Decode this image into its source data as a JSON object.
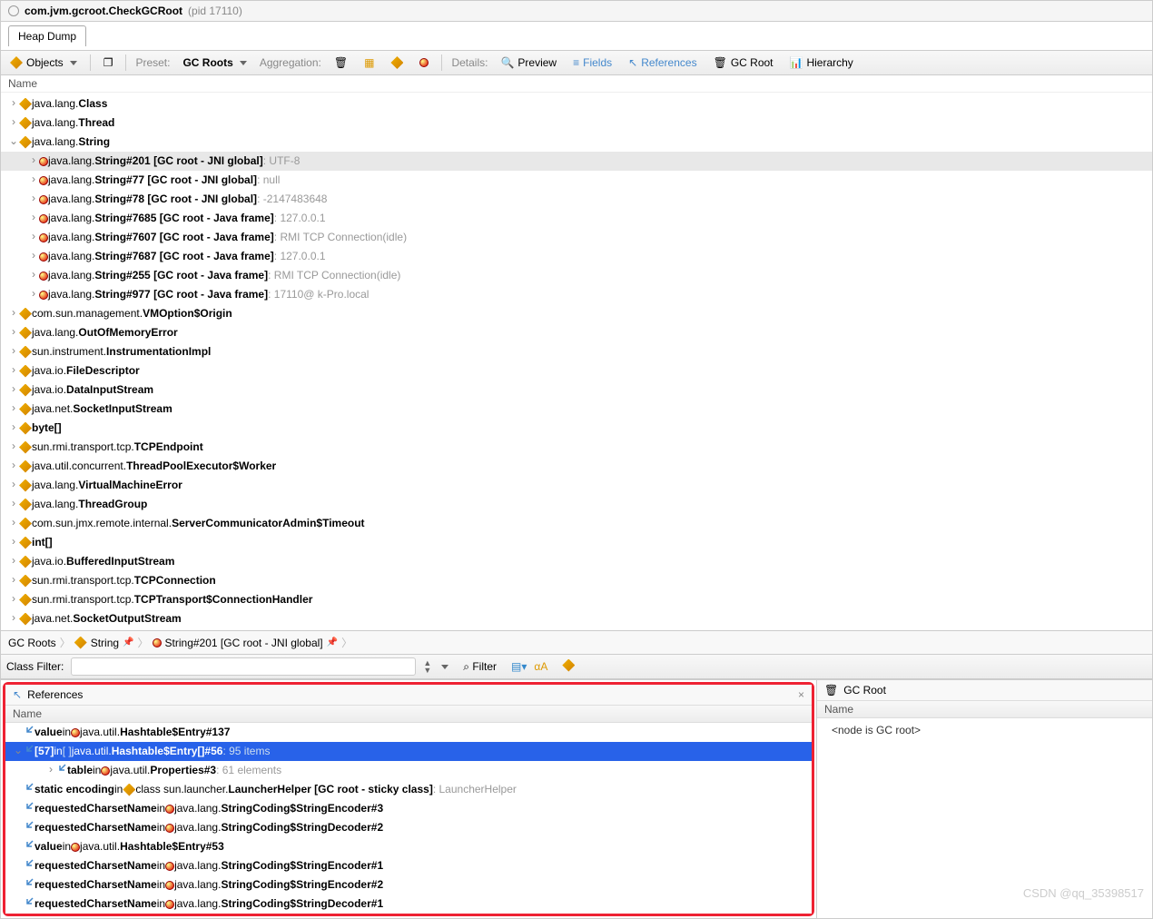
{
  "title": {
    "cls": "com.jvm.gcroot.CheckGCRoot",
    "pid": "(pid 17110)"
  },
  "tab": "Heap Dump",
  "toolbar": {
    "objects": "Objects",
    "preset_lbl": "Preset:",
    "preset_val": "GC Roots",
    "agg_lbl": "Aggregation:",
    "details_lbl": "Details:",
    "preview": "Preview",
    "fields": "Fields",
    "refs": "References",
    "gcroot": "GC Root",
    "hierarchy": "Hierarchy"
  },
  "tree_head": "Name",
  "tree": [
    {
      "lvl": 0,
      "chev": "›",
      "t": "class",
      "pkg": "java.lang.",
      "cls": "Class"
    },
    {
      "lvl": 0,
      "chev": "›",
      "t": "class",
      "pkg": "java.lang.",
      "cls": "Thread"
    },
    {
      "lvl": 0,
      "chev": "⌄",
      "t": "class",
      "pkg": "java.lang.",
      "cls": "String"
    },
    {
      "lvl": 1,
      "chev": "›",
      "t": "inst",
      "sel": true,
      "pkg": "java.lang.",
      "cls": "String#201 [GC root - JNI global]",
      "extra": " : UTF-8"
    },
    {
      "lvl": 1,
      "chev": "›",
      "t": "inst",
      "pkg": "java.lang.",
      "cls": "String#77 [GC root - JNI global]",
      "extra": " : null"
    },
    {
      "lvl": 1,
      "chev": "›",
      "t": "inst",
      "pkg": "java.lang.",
      "cls": "String#78 [GC root - JNI global]",
      "extra": " : -2147483648"
    },
    {
      "lvl": 1,
      "chev": "›",
      "t": "inst",
      "pkg": "java.lang.",
      "cls": "String#7685 [GC root - Java frame]",
      "extra": " : 127.0.0.1"
    },
    {
      "lvl": 1,
      "chev": "›",
      "t": "inst",
      "pkg": "java.lang.",
      "cls": "String#7607 [GC root - Java frame]",
      "extra": " : RMI TCP Connection(idle)"
    },
    {
      "lvl": 1,
      "chev": "›",
      "t": "inst",
      "pkg": "java.lang.",
      "cls": "String#7687 [GC root - Java frame]",
      "extra": " : 127.0.0.1"
    },
    {
      "lvl": 1,
      "chev": "›",
      "t": "inst",
      "pkg": "java.lang.",
      "cls": "String#255 [GC root - Java frame]",
      "extra": " : RMI TCP Connection(idle)"
    },
    {
      "lvl": 1,
      "chev": "›",
      "t": "inst",
      "pkg": "java.lang.",
      "cls": "String#977 [GC root - Java frame]",
      "extra": " : 17110@            k-Pro.local"
    },
    {
      "lvl": 0,
      "chev": "›",
      "t": "class",
      "pkg": "com.sun.management.",
      "cls": "VMOption$Origin"
    },
    {
      "lvl": 0,
      "chev": "›",
      "t": "class",
      "pkg": "java.lang.",
      "cls": "OutOfMemoryError"
    },
    {
      "lvl": 0,
      "chev": "›",
      "t": "class",
      "pkg": "sun.instrument.",
      "cls": "InstrumentationImpl"
    },
    {
      "lvl": 0,
      "chev": "›",
      "t": "class",
      "pkg": "java.io.",
      "cls": "FileDescriptor"
    },
    {
      "lvl": 0,
      "chev": "›",
      "t": "class",
      "pkg": "java.io.",
      "cls": "DataInputStream"
    },
    {
      "lvl": 0,
      "chev": "›",
      "t": "class",
      "pkg": "java.net.",
      "cls": "SocketInputStream"
    },
    {
      "lvl": 0,
      "chev": "›",
      "t": "class",
      "pkg": "",
      "cls": "byte[]"
    },
    {
      "lvl": 0,
      "chev": "›",
      "t": "class",
      "pkg": "sun.rmi.transport.tcp.",
      "cls": "TCPEndpoint"
    },
    {
      "lvl": 0,
      "chev": "›",
      "t": "class",
      "pkg": "java.util.concurrent.",
      "cls": "ThreadPoolExecutor$Worker"
    },
    {
      "lvl": 0,
      "chev": "›",
      "t": "class",
      "pkg": "java.lang.",
      "cls": "VirtualMachineError"
    },
    {
      "lvl": 0,
      "chev": "›",
      "t": "class",
      "pkg": "java.lang.",
      "cls": "ThreadGroup"
    },
    {
      "lvl": 0,
      "chev": "›",
      "t": "class",
      "pkg": "com.sun.jmx.remote.internal.",
      "cls": "ServerCommunicatorAdmin$Timeout"
    },
    {
      "lvl": 0,
      "chev": "›",
      "t": "class",
      "pkg": "",
      "cls": "int[]"
    },
    {
      "lvl": 0,
      "chev": "›",
      "t": "class",
      "pkg": "java.io.",
      "cls": "BufferedInputStream"
    },
    {
      "lvl": 0,
      "chev": "›",
      "t": "class",
      "pkg": "sun.rmi.transport.tcp.",
      "cls": "TCPConnection"
    },
    {
      "lvl": 0,
      "chev": "›",
      "t": "class",
      "pkg": "sun.rmi.transport.tcp.",
      "cls": "TCPTransport$ConnectionHandler"
    },
    {
      "lvl": 0,
      "chev": "›",
      "t": "class",
      "pkg": "java.net.",
      "cls": "SocketOutputStream"
    }
  ],
  "breadcrumb": {
    "a": "GC Roots",
    "b": "String",
    "c": "String#201 [GC root - JNI global]"
  },
  "filter": {
    "lbl": "Class Filter:",
    "btn": "Filter"
  },
  "refs": {
    "title": "References",
    "head": "Name",
    "rows": [
      {
        "lvl": 0,
        "chev": "",
        "fld": "value",
        "in": " in ",
        "t": "inst",
        "pkg": "java.util.",
        "cls": "Hashtable$Entry#137"
      },
      {
        "lvl": 0,
        "chev": "⌄",
        "hl": true,
        "fld": "[57]",
        "in": " in ",
        "t": "arr",
        "pkg": "java.util.",
        "cls": "Hashtable$Entry[]#56",
        "extra": " : 95 items"
      },
      {
        "lvl": 2,
        "chev": "›",
        "fld": "table",
        "in": " in ",
        "t": "inst",
        "pkg": "java.util.",
        "cls": "Properties#3",
        "extra": " : 61 elements"
      },
      {
        "lvl": 0,
        "chev": "",
        "fld": "static encoding",
        "in": " in ",
        "t": "cls",
        "pkg": "class sun.launcher.",
        "cls": "LauncherHelper [GC root - sticky class]",
        "extra": " : LauncherHelper"
      },
      {
        "lvl": 0,
        "chev": "",
        "fld": "requestedCharsetName",
        "in": " in ",
        "t": "inst",
        "pkg": "java.lang.",
        "cls": "StringCoding$StringEncoder#3"
      },
      {
        "lvl": 0,
        "chev": "",
        "fld": "requestedCharsetName",
        "in": " in ",
        "t": "inst",
        "pkg": "java.lang.",
        "cls": "StringCoding$StringDecoder#2"
      },
      {
        "lvl": 0,
        "chev": "",
        "fld": "value",
        "in": " in ",
        "t": "inst",
        "pkg": "java.util.",
        "cls": "Hashtable$Entry#53"
      },
      {
        "lvl": 0,
        "chev": "",
        "fld": "requestedCharsetName",
        "in": " in ",
        "t": "inst",
        "pkg": "java.lang.",
        "cls": "StringCoding$StringEncoder#1"
      },
      {
        "lvl": 0,
        "chev": "",
        "fld": "requestedCharsetName",
        "in": " in ",
        "t": "inst",
        "pkg": "java.lang.",
        "cls": "StringCoding$StringEncoder#2"
      },
      {
        "lvl": 0,
        "chev": "",
        "fld": "requestedCharsetName",
        "in": " in ",
        "t": "inst",
        "pkg": "java.lang.",
        "cls": "StringCoding$StringDecoder#1"
      }
    ]
  },
  "gc": {
    "title": "GC Root",
    "head": "Name",
    "node": "<node is GC root>"
  },
  "watermark": "CSDN @qq_35398517"
}
